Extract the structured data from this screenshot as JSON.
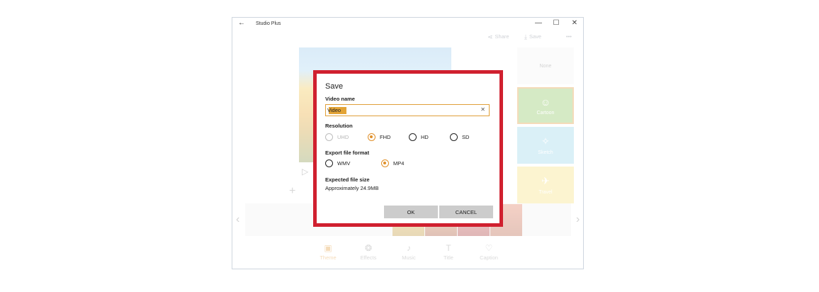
{
  "app": {
    "title": "Studio Plus"
  },
  "window_controls": {
    "back": "←",
    "minimize": "—",
    "maximize": "☐",
    "close": "✕"
  },
  "toolbar": {
    "share_label": "Share",
    "save_label": "Save",
    "more": "•••"
  },
  "effects": {
    "none_label": "None",
    "tile1_label": "Cartoon",
    "tile2_label": "Sketch",
    "tile3_label": "Travel"
  },
  "bottom_tabs": [
    {
      "label": "Theme",
      "icon": "theme-icon"
    },
    {
      "label": "Effects",
      "icon": "effects-icon"
    },
    {
      "label": "Music",
      "icon": "music-note-icon"
    },
    {
      "label": "Title",
      "icon": "title-t-icon"
    },
    {
      "label": "Caption",
      "icon": "caption-bubble-icon"
    }
  ],
  "dialog": {
    "title": "Save",
    "video_name_label": "Video name",
    "video_name_value": "Video",
    "resolution_label": "Resolution",
    "resolution_options": [
      "UHD",
      "FHD",
      "HD",
      "SD"
    ],
    "resolution_selected": "FHD",
    "resolution_disabled": "UHD",
    "format_label": "Export file format",
    "format_options": [
      "WMV",
      "MP4"
    ],
    "format_selected": "MP4",
    "size_label": "Expected file size",
    "size_value": "Approximately 24.9MB",
    "ok_label": "OK",
    "cancel_label": "CANCEL"
  },
  "colors": {
    "accent": "#e0902a",
    "highlight_border": "#d0202f",
    "button_gray": "#cccccc"
  }
}
